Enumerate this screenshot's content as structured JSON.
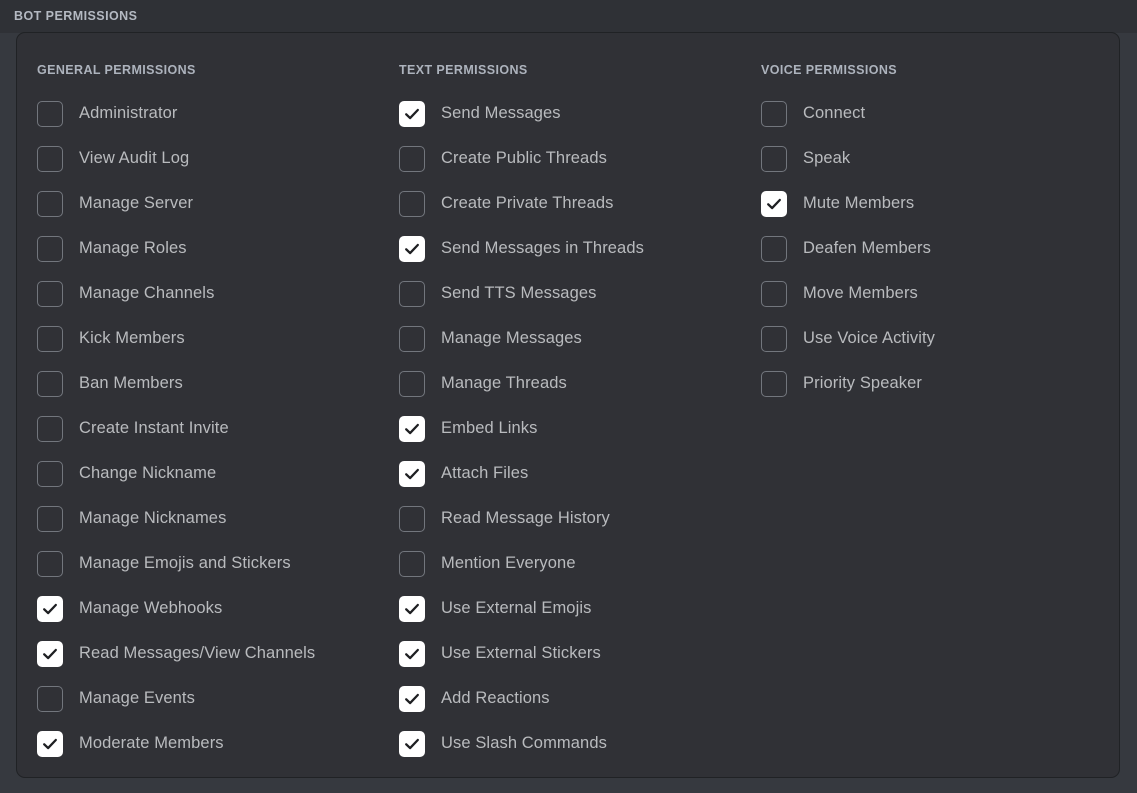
{
  "header": {
    "title": "BOT PERMISSIONS"
  },
  "colors": {
    "page_background": "#36393f",
    "topbar_background": "#2f3136",
    "panel_background": "#303136",
    "panel_border": "#202225",
    "label_text": "#b9bbbe",
    "header_text": "#adb3bd",
    "checkbox_border": "#72767d",
    "checkbox_checked_background": "#ffffff",
    "checkmark": "#1e1f22"
  },
  "icons": {
    "check": "check-icon"
  },
  "columns": [
    {
      "id": "general",
      "header": "GENERAL PERMISSIONS",
      "permissions": [
        {
          "label": "Administrator",
          "checked": false
        },
        {
          "label": "View Audit Log",
          "checked": false
        },
        {
          "label": "Manage Server",
          "checked": false
        },
        {
          "label": "Manage Roles",
          "checked": false
        },
        {
          "label": "Manage Channels",
          "checked": false
        },
        {
          "label": "Kick Members",
          "checked": false
        },
        {
          "label": "Ban Members",
          "checked": false
        },
        {
          "label": "Create Instant Invite",
          "checked": false
        },
        {
          "label": "Change Nickname",
          "checked": false
        },
        {
          "label": "Manage Nicknames",
          "checked": false
        },
        {
          "label": "Manage Emojis and Stickers",
          "checked": false
        },
        {
          "label": "Manage Webhooks",
          "checked": true
        },
        {
          "label": "Read Messages/View Channels",
          "checked": true
        },
        {
          "label": "Manage Events",
          "checked": false
        },
        {
          "label": "Moderate Members",
          "checked": true
        }
      ]
    },
    {
      "id": "text",
      "header": "TEXT PERMISSIONS",
      "permissions": [
        {
          "label": "Send Messages",
          "checked": true
        },
        {
          "label": "Create Public Threads",
          "checked": false
        },
        {
          "label": "Create Private Threads",
          "checked": false
        },
        {
          "label": "Send Messages in Threads",
          "checked": true
        },
        {
          "label": "Send TTS Messages",
          "checked": false
        },
        {
          "label": "Manage Messages",
          "checked": false
        },
        {
          "label": "Manage Threads",
          "checked": false
        },
        {
          "label": "Embed Links",
          "checked": true
        },
        {
          "label": "Attach Files",
          "checked": true
        },
        {
          "label": "Read Message History",
          "checked": false
        },
        {
          "label": "Mention Everyone",
          "checked": false
        },
        {
          "label": "Use External Emojis",
          "checked": true
        },
        {
          "label": "Use External Stickers",
          "checked": true
        },
        {
          "label": "Add Reactions",
          "checked": true
        },
        {
          "label": "Use Slash Commands",
          "checked": true
        }
      ]
    },
    {
      "id": "voice",
      "header": "VOICE PERMISSIONS",
      "permissions": [
        {
          "label": "Connect",
          "checked": false
        },
        {
          "label": "Speak",
          "checked": false
        },
        {
          "label": "Mute Members",
          "checked": true
        },
        {
          "label": "Deafen Members",
          "checked": false
        },
        {
          "label": "Move Members",
          "checked": false
        },
        {
          "label": "Use Voice Activity",
          "checked": false
        },
        {
          "label": "Priority Speaker",
          "checked": false
        }
      ]
    }
  ]
}
